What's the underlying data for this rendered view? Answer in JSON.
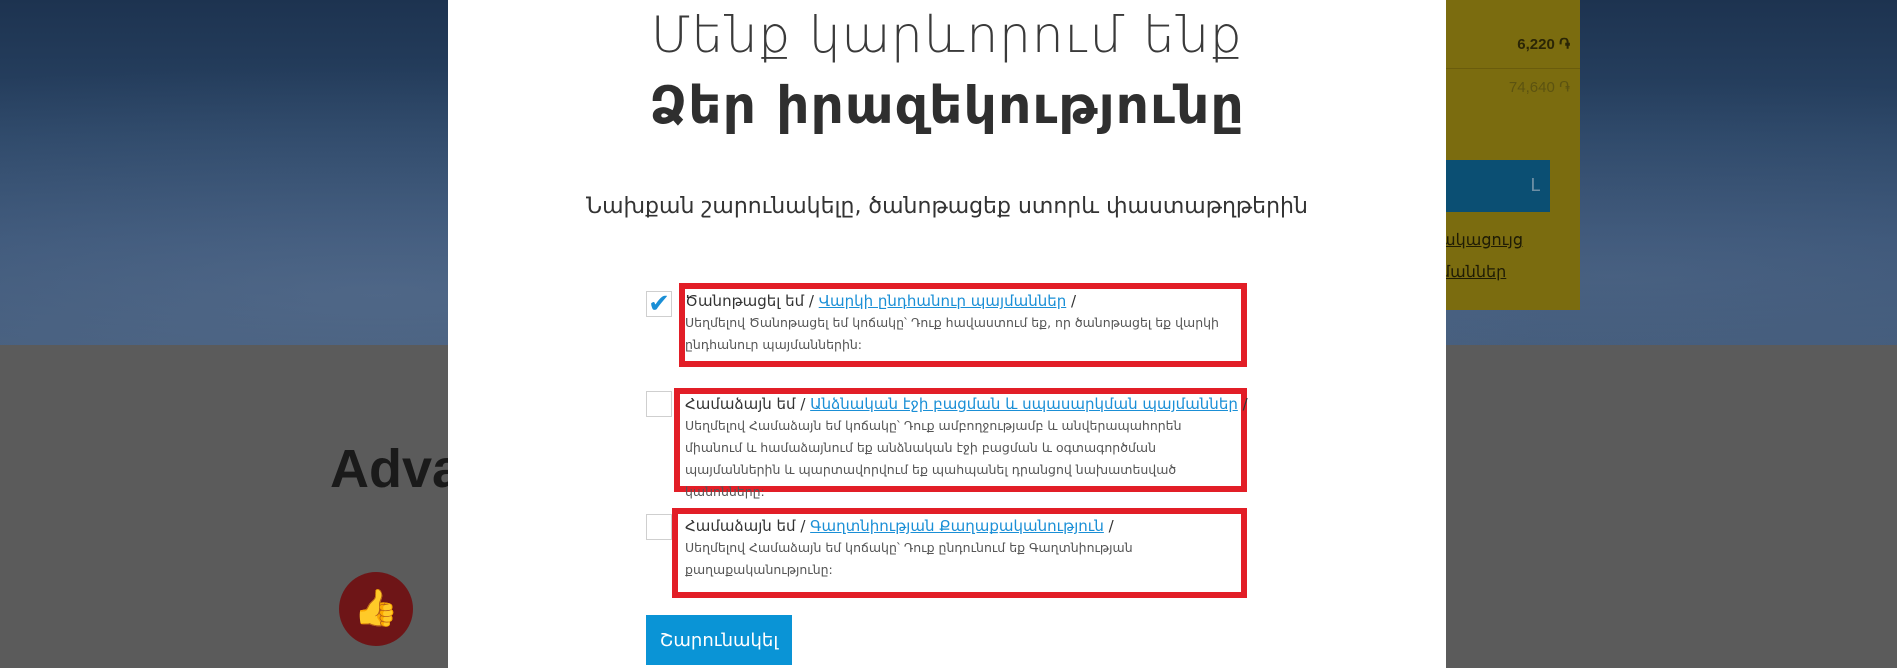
{
  "background": {
    "heading": "Adva",
    "prices": [
      "6,220 ֏",
      "74,640 ֏"
    ],
    "panel_button": "Լ",
    "panel_links": [
      "ակացույց",
      "մաններ"
    ],
    "thumb_icon": "thumbs-up-icon"
  },
  "modal": {
    "title_line1": "Մենք կարևորում ենք",
    "title_line2": "Ձեր իրազեկությունը",
    "subtitle": "Նախքան շարունակելը, ծանոթացեք ստորև փաստաթղթերին",
    "items": [
      {
        "checked": true,
        "prefix": "Ծանոթացել եմ / ",
        "link": "Վարկի ընդհանուր պայմաններ",
        "suffix": " /",
        "description": "Սեղմելով Ծանոթացել եմ կոճակը՝ Դուք հավաստում եք, որ ծանոթացել եք վարկի ընդհանուր պայմաններին:"
      },
      {
        "checked": false,
        "prefix": "Համաձայն եմ / ",
        "link": "Անձնական էջի բացման և սպասարկման պայմաններ",
        "suffix": " /",
        "description": "Սեղմելով Համաձայն եմ կոճակը՝ Դուք ամբողջությամբ և անվերապահորեն միանում և համաձայնում եք անձնական էջի բացման և օգտագործման պայմաններին և պարտավորվում եք պահպանել դրանցով նախատեսված կանոնները:"
      },
      {
        "checked": false,
        "prefix": "Համաձայն եմ / ",
        "link": "Գաղտնիության Քաղաքականություն",
        "suffix": " /",
        "description": "Սեղմելով Համաձայն եմ կոճակը՝ Դուք ընդունում եք Գաղտնիության քաղաքականությունը:"
      }
    ],
    "submit_label": "Շարունակել"
  },
  "colors": {
    "highlight_box": "#e21e27",
    "link": "#1a8fd6",
    "button": "#0a94d6"
  }
}
